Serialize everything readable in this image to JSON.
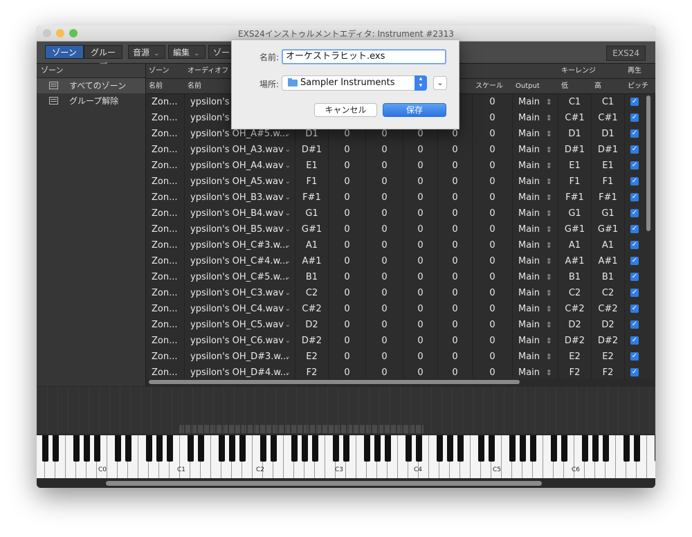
{
  "window": {
    "title": "EXS24インストゥルメントエディタ: Instrument #2313",
    "colors": {
      "close": "#c9c9c9",
      "minimize": "#f5bf4f",
      "zoom": "#5fc454",
      "accent": "#2f7de1"
    }
  },
  "toolbar": {
    "tabs": [
      "ゾーン",
      "グループ"
    ],
    "menus": [
      "音源",
      "編集",
      "ゾー"
    ],
    "badge": "EXS24"
  },
  "sidebar": {
    "header": "ゾーン",
    "items": [
      {
        "label": "すべてのゾーン",
        "icon": "zones-icon",
        "selected": true
      },
      {
        "label": "グループ解除",
        "icon": "group-list-icon",
        "selected": false
      }
    ]
  },
  "table": {
    "group_headers": {
      "zone": "ゾーン",
      "audio": "オーディオフ",
      "keyrange": "キーレンジ",
      "play": "再生"
    },
    "columns": {
      "name1": "名前",
      "name2": "名前",
      "scale": "スケール",
      "output": "Output",
      "low": "低",
      "high": "高",
      "pitch": "ピッチ"
    },
    "rows": [
      {
        "zone": "Zon...",
        "file": "ypsilon's O",
        "key": "",
        "v1": "",
        "v2": "",
        "v3": "",
        "v4": "",
        "scale": "0",
        "output": "Main",
        "low": "C1",
        "high": "C1"
      },
      {
        "zone": "Zon...",
        "file": "ypsilon's O",
        "key": "",
        "v1": "",
        "v2": "",
        "v3": "",
        "v4": "",
        "scale": "0",
        "output": "Main",
        "low": "C#1",
        "high": "C#1"
      },
      {
        "zone": "Zon...",
        "file": "ypsilon's OH_A#5.w...",
        "key": "D1",
        "v1": "0",
        "v2": "0",
        "v3": "0",
        "v4": "0",
        "scale": "0",
        "output": "Main",
        "low": "D1",
        "high": "D1"
      },
      {
        "zone": "Zon...",
        "file": "ypsilon's OH_A3.wav",
        "key": "D#1",
        "v1": "0",
        "v2": "0",
        "v3": "0",
        "v4": "0",
        "scale": "0",
        "output": "Main",
        "low": "D#1",
        "high": "D#1"
      },
      {
        "zone": "Zon...",
        "file": "ypsilon's OH_A4.wav",
        "key": "E1",
        "v1": "0",
        "v2": "0",
        "v3": "0",
        "v4": "0",
        "scale": "0",
        "output": "Main",
        "low": "E1",
        "high": "E1"
      },
      {
        "zone": "Zon...",
        "file": "ypsilon's OH_A5.wav",
        "key": "F1",
        "v1": "0",
        "v2": "0",
        "v3": "0",
        "v4": "0",
        "scale": "0",
        "output": "Main",
        "low": "F1",
        "high": "F1"
      },
      {
        "zone": "Zon...",
        "file": "ypsilon's OH_B3.wav",
        "key": "F#1",
        "v1": "0",
        "v2": "0",
        "v3": "0",
        "v4": "0",
        "scale": "0",
        "output": "Main",
        "low": "F#1",
        "high": "F#1"
      },
      {
        "zone": "Zon...",
        "file": "ypsilon's OH_B4.wav",
        "key": "G1",
        "v1": "0",
        "v2": "0",
        "v3": "0",
        "v4": "0",
        "scale": "0",
        "output": "Main",
        "low": "G1",
        "high": "G1"
      },
      {
        "zone": "Zon...",
        "file": "ypsilon's OH_B5.wav",
        "key": "G#1",
        "v1": "0",
        "v2": "0",
        "v3": "0",
        "v4": "0",
        "scale": "0",
        "output": "Main",
        "low": "G#1",
        "high": "G#1"
      },
      {
        "zone": "Zon...",
        "file": "ypsilon's OH_C#3.w...",
        "key": "A1",
        "v1": "0",
        "v2": "0",
        "v3": "0",
        "v4": "0",
        "scale": "0",
        "output": "Main",
        "low": "A1",
        "high": "A1"
      },
      {
        "zone": "Zon...",
        "file": "ypsilon's OH_C#4.w...",
        "key": "A#1",
        "v1": "0",
        "v2": "0",
        "v3": "0",
        "v4": "0",
        "scale": "0",
        "output": "Main",
        "low": "A#1",
        "high": "A#1"
      },
      {
        "zone": "Zon...",
        "file": "ypsilon's OH_C#5.w...",
        "key": "B1",
        "v1": "0",
        "v2": "0",
        "v3": "0",
        "v4": "0",
        "scale": "0",
        "output": "Main",
        "low": "B1",
        "high": "B1"
      },
      {
        "zone": "Zon...",
        "file": "ypsilon's OH_C3.wav",
        "key": "C2",
        "v1": "0",
        "v2": "0",
        "v3": "0",
        "v4": "0",
        "scale": "0",
        "output": "Main",
        "low": "C2",
        "high": "C2"
      },
      {
        "zone": "Zon...",
        "file": "ypsilon's OH_C4.wav",
        "key": "C#2",
        "v1": "0",
        "v2": "0",
        "v3": "0",
        "v4": "0",
        "scale": "0",
        "output": "Main",
        "low": "C#2",
        "high": "C#2"
      },
      {
        "zone": "Zon...",
        "file": "ypsilon's OH_C5.wav",
        "key": "D2",
        "v1": "0",
        "v2": "0",
        "v3": "0",
        "v4": "0",
        "scale": "0",
        "output": "Main",
        "low": "D2",
        "high": "D2"
      },
      {
        "zone": "Zon...",
        "file": "ypsilon's OH_C6.wav",
        "key": "D#2",
        "v1": "0",
        "v2": "0",
        "v3": "0",
        "v4": "0",
        "scale": "0",
        "output": "Main",
        "low": "D#2",
        "high": "D#2"
      },
      {
        "zone": "Zon...",
        "file": "ypsilon's OH_D#3.w...",
        "key": "E2",
        "v1": "0",
        "v2": "0",
        "v3": "0",
        "v4": "0",
        "scale": "0",
        "output": "Main",
        "low": "E2",
        "high": "E2"
      },
      {
        "zone": "Zon...",
        "file": "ypsilon's OH_D#4.w...",
        "key": "F2",
        "v1": "0",
        "v2": "0",
        "v3": "0",
        "v4": "0",
        "scale": "0",
        "output": "Main",
        "low": "F2",
        "high": "F2"
      }
    ]
  },
  "keyboard": {
    "labels": [
      "C0",
      "C1",
      "C2",
      "C3",
      "C4",
      "C5",
      "C6"
    ]
  },
  "save_dialog": {
    "name_label": "名前:",
    "name_value": "オーケストラヒット.exs",
    "location_label": "場所:",
    "location_value": "Sampler Instruments",
    "cancel_label": "キャンセル",
    "save_label": "保存"
  }
}
